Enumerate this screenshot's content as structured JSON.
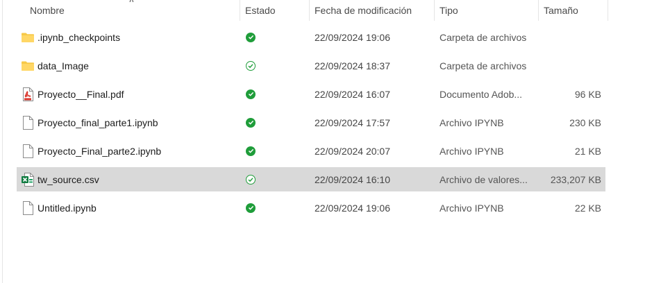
{
  "columns": {
    "name": "Nombre",
    "status": "Estado",
    "date": "Fecha de modificación",
    "type": "Tipo",
    "size": "Tamaño"
  },
  "status_colors": {
    "synced": "#1f9d3a",
    "available": "#1f9d3a"
  },
  "files": [
    {
      "icon": "folder-icon",
      "name": ".ipynb_checkpoints",
      "status": "synced-icon",
      "date": "22/09/2024 19:06",
      "type": "Carpeta de archivos",
      "size": ""
    },
    {
      "icon": "folder-icon",
      "name": "data_Image",
      "status": "available-icon",
      "date": "22/09/2024 18:37",
      "type": "Carpeta de archivos",
      "size": ""
    },
    {
      "icon": "pdf-icon",
      "name": "Proyecto__Final.pdf",
      "status": "synced-icon",
      "date": "22/09/2024 16:07",
      "type": "Documento Adob...",
      "size": "96 KB"
    },
    {
      "icon": "file-icon",
      "name": "Proyecto_final_parte1.ipynb",
      "status": "synced-icon",
      "date": "22/09/2024 17:57",
      "type": "Archivo IPYNB",
      "size": "230 KB"
    },
    {
      "icon": "file-icon",
      "name": "Proyecto_Final_parte2.ipynb",
      "status": "synced-icon",
      "date": "22/09/2024 20:07",
      "type": "Archivo IPYNB",
      "size": "21 KB"
    },
    {
      "icon": "excel-csv-icon",
      "name": "tw_source.csv",
      "status": "available-icon",
      "date": "22/09/2024 16:10",
      "type": "Archivo de valores...",
      "size": "233,207 KB",
      "selected": true
    },
    {
      "icon": "file-icon",
      "name": "Untitled.ipynb",
      "status": "synced-icon",
      "date": "22/09/2024 19:06",
      "type": "Archivo IPYNB",
      "size": "22 KB"
    }
  ]
}
